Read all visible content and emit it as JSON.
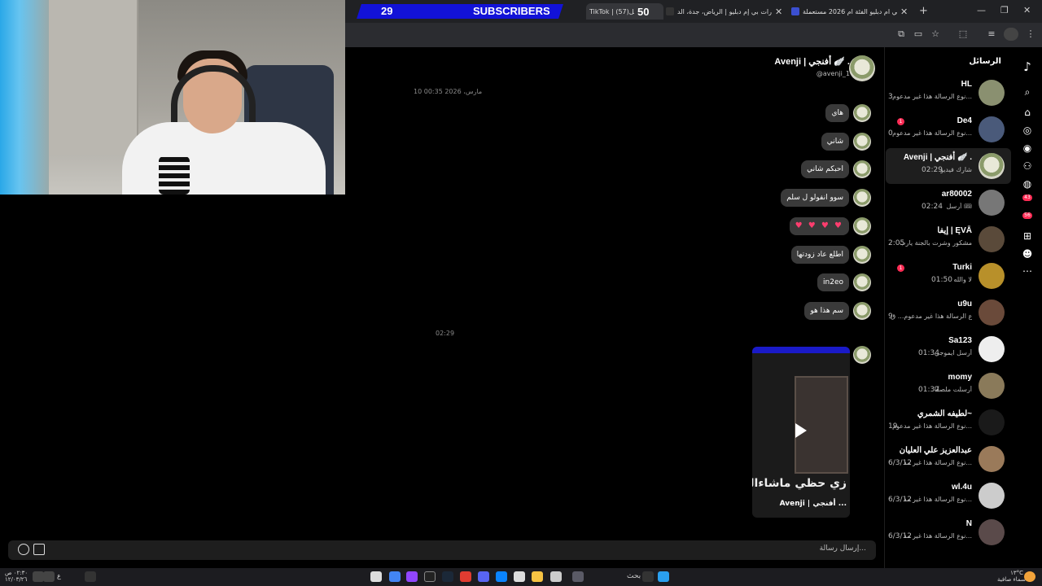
{
  "stream_overlay": {
    "subscribers_count": "29",
    "subscribers_label": "SUBSCRIBERS"
  },
  "browser": {
    "tabs": [
      {
        "title": "TikTok | (57)الرسائل",
        "count": "50"
      },
      {
        "title": "عروض سيارات بي إم دبليو | الرياض، جدة، الد"
      },
      {
        "title": "سيارات بي ام دبليو الفئة ام 2026 مستعملة"
      }
    ],
    "new_tab_label": "+",
    "window_controls": [
      "—",
      "❐",
      "✕"
    ]
  },
  "tiktok": {
    "sidebar_title": "الرسائل",
    "chat_header": {
      "name": "Avenji | أفنجي 🪽 .",
      "handle": "@avenji_1"
    },
    "timestamps": [
      "10 مارس، 2026 00:35",
      "02:29"
    ],
    "messages": [
      "هاي",
      "شاني",
      "احبكم شاني",
      "سوو انفولو ل سلم",
      "♥ ♥ ♥ ♥",
      "اطلع عاد زودتها",
      "in2eo",
      "سم هذا هو"
    ],
    "video_card": {
      "caption": "زي حظي ماشاءالله",
      "author": "Avenji | أفنجي ..."
    },
    "composer_placeholder": "إرسال رسالة...",
    "conversations": [
      {
        "name": "HL",
        "preview": "نوع الرسالة هذا غير مدعوم...",
        "time": "3",
        "badge": ""
      },
      {
        "name": "De4",
        "preview": "نوع الرسالة هذا غير مدعوم...",
        "time": "0",
        "badge": "1"
      },
      {
        "name": "Avenji | أفنجي 🪽 .",
        "preview": "شارك فيديو",
        "time": "02:29",
        "badge": ""
      },
      {
        "name": "ar80002",
        "preview": "أرسل 🎟",
        "time": "02:24",
        "badge": ""
      },
      {
        "name": "إيفا | ĘVĀ",
        "preview": "مشكور وشرت بالجنة يارب",
        "time": "2:05",
        "badge": ""
      },
      {
        "name": "Turki",
        "preview": "لا والله",
        "time": "01:50",
        "badge": "1"
      },
      {
        "name": "u9u",
        "preview": "نوع الرسالة هذا غير مدعوم... ق",
        "time": "9",
        "badge": ""
      },
      {
        "name": "Sa123",
        "preview": "أرسل ايموجي",
        "time": "01:34",
        "badge": ""
      },
      {
        "name": "momy",
        "preview": "أرسلت ملصقًا",
        "time": "01:32",
        "badge": ""
      },
      {
        "name": "لطيفه الشمري~",
        "preview": "نوع الرسالة هذا غير مدعوم...",
        "time": "19",
        "badge": ""
      },
      {
        "name": "عبدالعزيز علي العليان",
        "preview": "نوع الرسالة هذا غير مد...",
        "time": "6/3/12",
        "badge": ""
      },
      {
        "name": "wl.4u",
        "preview": "نوع الرسالة هذا غير مد...",
        "time": "6/3/12",
        "badge": ""
      },
      {
        "name": "N",
        "preview": "نوع الرسالة هذا غير مد...",
        "time": "6/3/12",
        "badge": ""
      }
    ],
    "rail_badges": [
      "43",
      "56"
    ]
  },
  "taskbar": {
    "search_label": "بحث",
    "clock": "٠٢:٣٠ ص\n١٢/٠٣/٢٦",
    "language": "ع",
    "weather": "١٣°C\nسماء صافية"
  },
  "colors": {
    "accent_red": "#fe2c55",
    "banner_blue": "#1212d8"
  }
}
